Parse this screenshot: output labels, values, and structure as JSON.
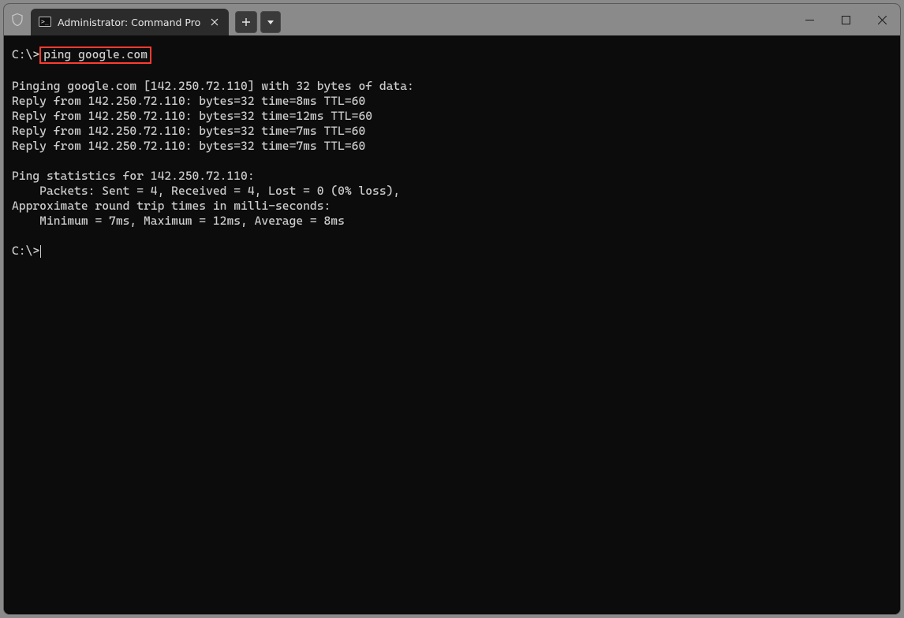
{
  "tab": {
    "title": "Administrator: Command Pro",
    "icon_name": "cmd-icon"
  },
  "terminal": {
    "prompt1_path": "C:\\>",
    "command": "ping google.com",
    "output_lines": [
      "",
      "Pinging google.com [142.250.72.110] with 32 bytes of data:",
      "Reply from 142.250.72.110: bytes=32 time=8ms TTL=60",
      "Reply from 142.250.72.110: bytes=32 time=12ms TTL=60",
      "Reply from 142.250.72.110: bytes=32 time=7ms TTL=60",
      "Reply from 142.250.72.110: bytes=32 time=7ms TTL=60",
      "",
      "Ping statistics for 142.250.72.110:",
      "    Packets: Sent = 4, Received = 4, Lost = 0 (0% loss),",
      "Approximate round trip times in milli-seconds:",
      "    Minimum = 7ms, Maximum = 12ms, Average = 8ms",
      ""
    ],
    "prompt2_path": "C:\\>"
  },
  "colors": {
    "highlight_border": "#ff3b30",
    "terminal_bg": "#0c0c0c",
    "terminal_fg": "#cccccc",
    "titlebar_bg": "#8a8a8a",
    "tab_bg": "#2b2b2b"
  }
}
